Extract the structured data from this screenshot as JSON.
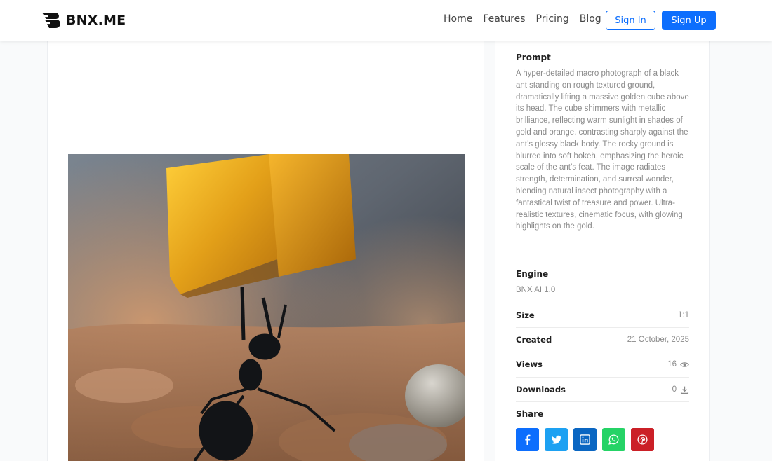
{
  "header": {
    "logo_text": "BNX.ME",
    "nav": [
      "Home",
      "Features",
      "Pricing",
      "Blog"
    ],
    "signin_label": "Sign In",
    "signup_label": "Sign Up"
  },
  "details": {
    "prompt_label": "Prompt",
    "prompt_text": "A hyper-detailed macro photograph of a black ant standing on rough textured ground, dramatically lifting a massive golden cube above its head. The cube shimmers with metallic brilliance, reflecting warm sunlight in shades of gold and orange, contrasting sharply against the ant’s glossy black body. The rocky ground is blurred into soft bokeh, emphasizing the heroic scale of the ant’s feat. The image radiates strength, determination, and surreal wonder, blending natural insect photography with a fantastical twist of treasure and power. Ultra-realistic textures, cinematic focus, with glowing highlights on the gold.",
    "engine_label": "Engine",
    "engine_value": "BNX AI 1.0",
    "size_label": "Size",
    "size_value": "1:1",
    "created_label": "Created",
    "created_value": "21 October, 2025",
    "views_label": "Views",
    "views_value": "16",
    "downloads_label": "Downloads",
    "downloads_value": "0",
    "share_label": "Share"
  },
  "share": [
    {
      "name": "facebook-icon",
      "color": "#0d6efd"
    },
    {
      "name": "twitter-icon",
      "color": "#1da1f2"
    },
    {
      "name": "linkedin-icon",
      "color": "#0a66c2"
    },
    {
      "name": "whatsapp-icon",
      "color": "#25d366"
    },
    {
      "name": "pinterest-icon",
      "color": "#cb2027"
    }
  ],
  "colors": {
    "accent": "#0d6efd",
    "gold": "#e0a020"
  }
}
